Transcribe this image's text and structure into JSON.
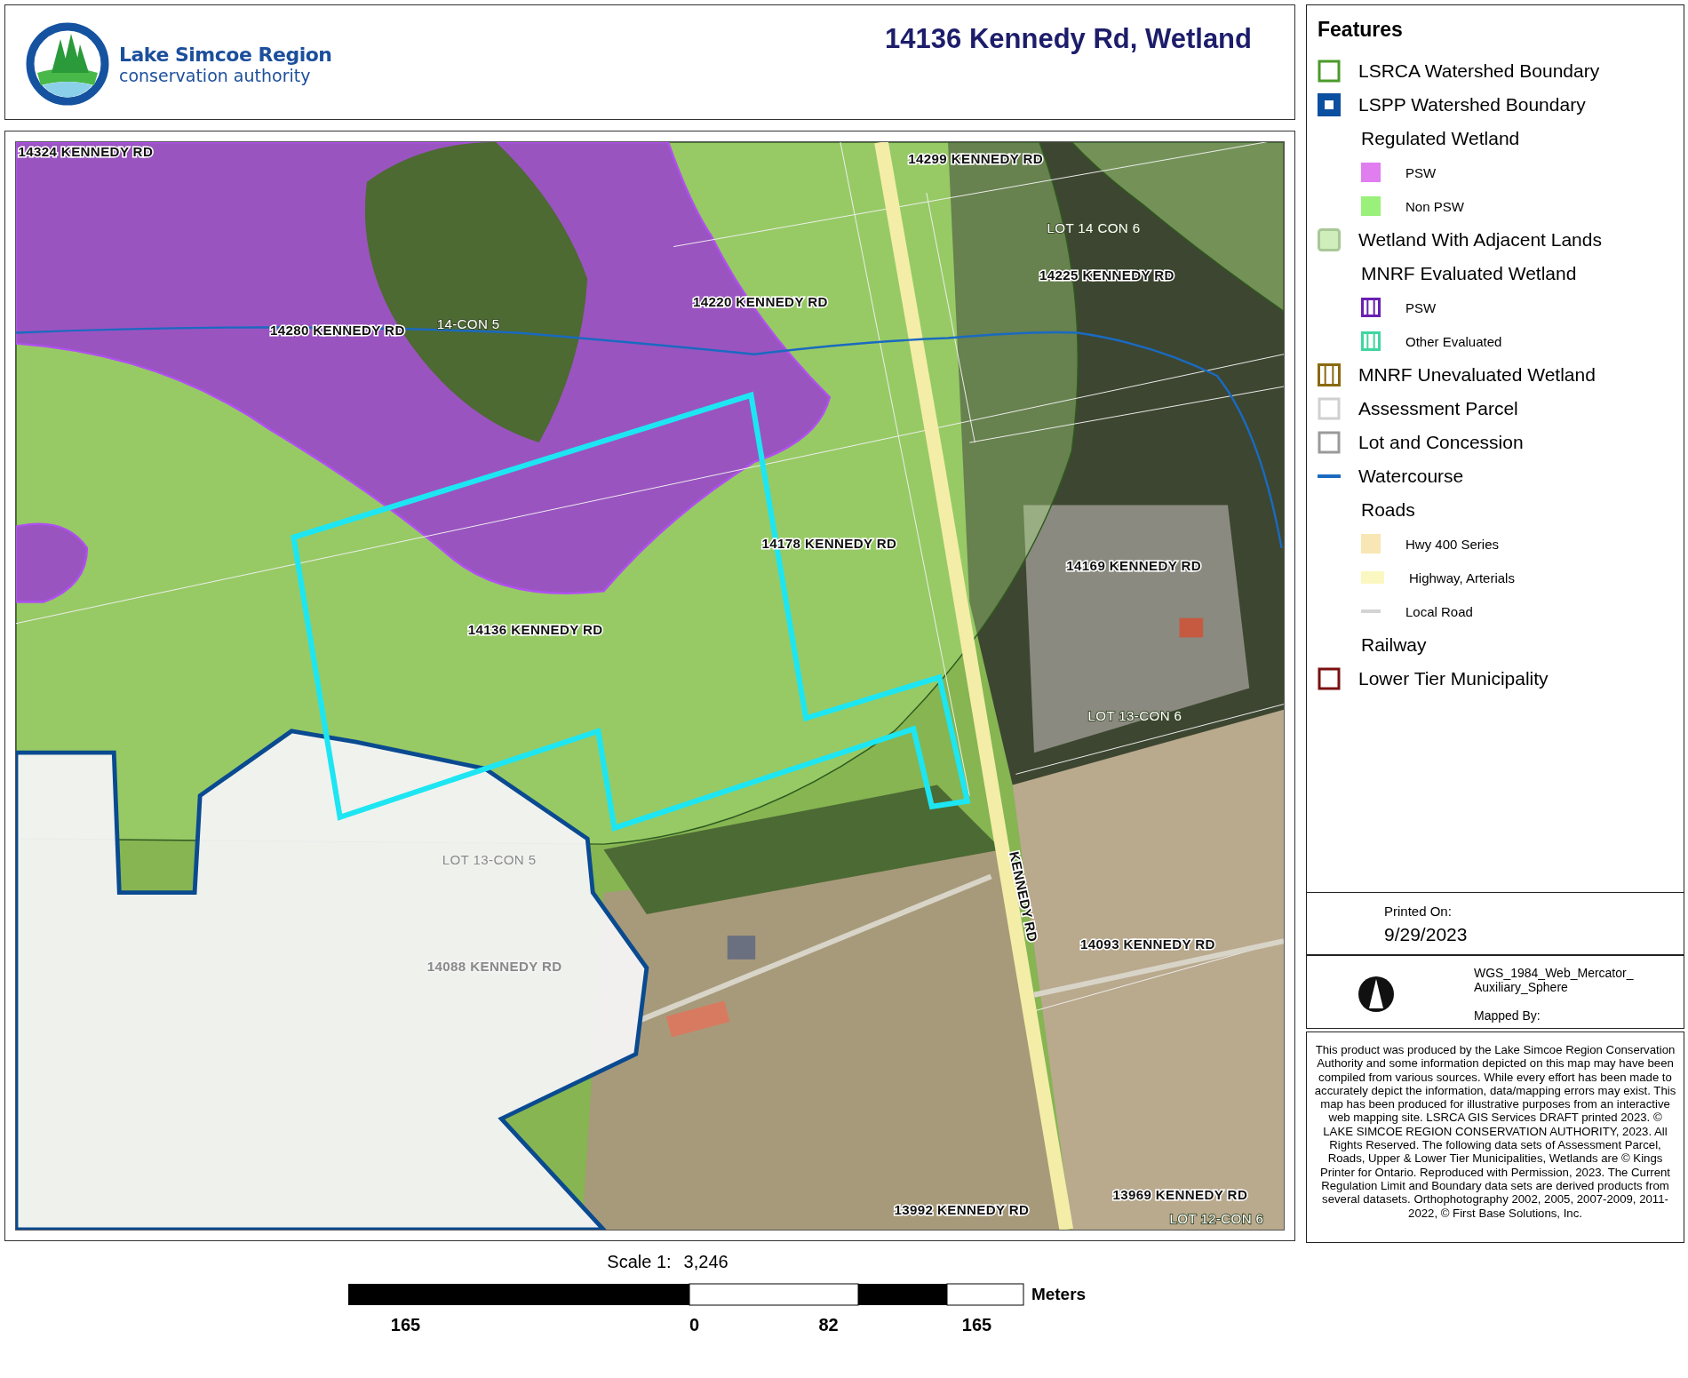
{
  "header": {
    "logo_name": "Lake Simcoe Region",
    "logo_subtitle": "conservation authority",
    "title": "14136 Kennedy Rd, Wetland"
  },
  "map": {
    "labels": [
      {
        "text": "14324 KENNEDY RD",
        "kind": "address",
        "faded": false
      },
      {
        "text": "14299 KENNEDY RD",
        "kind": "address",
        "faded": false
      },
      {
        "text": "LOT 14 CON 6",
        "kind": "lot",
        "faded": false
      },
      {
        "text": "14225 KENNEDY RD",
        "kind": "address",
        "faded": false
      },
      {
        "text": "14220 KENNEDY RD",
        "kind": "address",
        "faded": false
      },
      {
        "text": "14280 KENNEDY RD",
        "kind": "address",
        "faded": false
      },
      {
        "text": "14-CON 5",
        "kind": "lot",
        "faded": false
      },
      {
        "text": "14178 KENNEDY RD",
        "kind": "address",
        "faded": false
      },
      {
        "text": "14169 KENNEDY RD",
        "kind": "address",
        "faded": false
      },
      {
        "text": "14136 KENNEDY RD",
        "kind": "address",
        "faded": false
      },
      {
        "text": "LOT 13-CON 6",
        "kind": "lot",
        "faded": false
      },
      {
        "text": "LOT 13-CON 5",
        "kind": "lot",
        "faded": true
      },
      {
        "text": "14088 KENNEDY RD",
        "kind": "address",
        "faded": true
      },
      {
        "text": "KENNEDY RD",
        "kind": "road",
        "faded": false
      },
      {
        "text": "14093 KENNEDY RD",
        "kind": "address",
        "faded": false
      },
      {
        "text": "13992 KENNEDY RD",
        "kind": "address",
        "faded": false
      },
      {
        "text": "13969 KENNEDY RD",
        "kind": "address",
        "faded": false
      },
      {
        "text": "LOT 12-CON 6",
        "kind": "lot",
        "faded": false
      }
    ]
  },
  "scale": {
    "label": "Scale 1:",
    "value": "3,246",
    "unit": "Meters",
    "ticks": [
      "165",
      "0",
      "82",
      "165"
    ]
  },
  "legend": {
    "title": "Features",
    "items": [
      {
        "label": "LSRCA Watershed Boundary",
        "kind": "outline",
        "color": "#4a9a2a"
      },
      {
        "label": "LSPP Watershed Boundary",
        "kind": "thick",
        "color": "#0b4fa0"
      },
      {
        "label": "Regulated Wetland",
        "kind": "heading",
        "children": [
          {
            "label": "PSW",
            "kind": "fill",
            "color": "#e07ef0"
          },
          {
            "label": "Non PSW",
            "kind": "fill",
            "color": "#99f07a"
          }
        ]
      },
      {
        "label": "Wetland With Adjacent Lands",
        "kind": "soft",
        "color": "#cfeebb"
      },
      {
        "label": "MNRF Evaluated Wetland",
        "kind": "heading",
        "children": [
          {
            "label": "PSW",
            "kind": "hatch",
            "color": "#6a1fb0"
          },
          {
            "label": "Other Evaluated",
            "kind": "hatch",
            "color": "#3fd6a0"
          }
        ]
      },
      {
        "label": "MNRF Unevaluated Wetland",
        "kind": "hatch",
        "color": "#8a6a10"
      },
      {
        "label": "Assessment Parcel",
        "kind": "outline",
        "color": "#d0d0d0"
      },
      {
        "label": "Lot and Concession",
        "kind": "outline",
        "color": "#9a9a9a"
      },
      {
        "label": "Watercourse",
        "kind": "line",
        "color": "#1a6ac0"
      },
      {
        "label": "Roads",
        "kind": "heading",
        "children": [
          {
            "label": "Hwy 400 Series",
            "kind": "fill",
            "color": "#f8e6b4"
          },
          {
            "label": "Highway, Arterials",
            "kind": "bar",
            "color": "#fbf7c0"
          },
          {
            "label": "Local Road",
            "kind": "line",
            "color": "#d4d4d4"
          }
        ]
      },
      {
        "label": "Railway",
        "kind": "heading"
      },
      {
        "label": "Lower Tier Municipality",
        "kind": "outline",
        "color": "#7a1010"
      }
    ]
  },
  "printed": {
    "label": "Printed On:",
    "date": "9/29/2023"
  },
  "projection": {
    "lines": [
      "WGS_1984_Web_Mercator_",
      "Auxiliary_Sphere"
    ],
    "mapped_by": "Mapped By:"
  },
  "disclaimer": "This product was produced by the Lake Simcoe Region Conservation Authority and some information depicted on this map may have been compiled from various sources. While every effort has been made to accurately depict the information, data/mapping errors may exist.  This map has been produced for illustrative purposes from an interactive web mapping site. LSRCA GIS Services DRAFT printed 2023. © LAKE SIMCOE REGION CONSERVATION AUTHORITY, 2023. All Rights Reserved. The following data sets of Assessment Parcel, Roads, Upper & Lower Tier Municipalities, Wetlands are © Kings Printer for Ontario. Reproduced with Permission, 2023. The Current Regulation Limit and Boundary data sets are derived products from several datasets. Orthophotography 2002, 2005, 2007-2009, 2011-2022,  © First Base Solutions, Inc."
}
